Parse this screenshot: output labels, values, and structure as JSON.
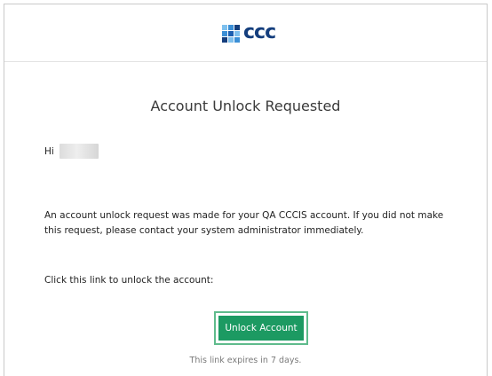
{
  "header": {
    "logo_text": "ccc",
    "logo_icon": "ccc-grid-logo-icon",
    "logo_colors": [
      "#7ec0ee",
      "#3b8fd6",
      "#143e7d",
      "#1c5fb0"
    ]
  },
  "email": {
    "title": "Account Unlock Requested",
    "greeting": "Hi",
    "message": "An account unlock request was made for your QA CCCIS account. If you did not make this request, please contact your system administrator immediately.",
    "link_prompt": "Click this link to unlock the account:",
    "unlock_button_label": "Unlock Account",
    "expiry_note": "This link expires in 7 days."
  },
  "colors": {
    "button_bg": "#1c9a62",
    "button_border": "#5fbb8c",
    "brand_blue": "#143e7d"
  }
}
